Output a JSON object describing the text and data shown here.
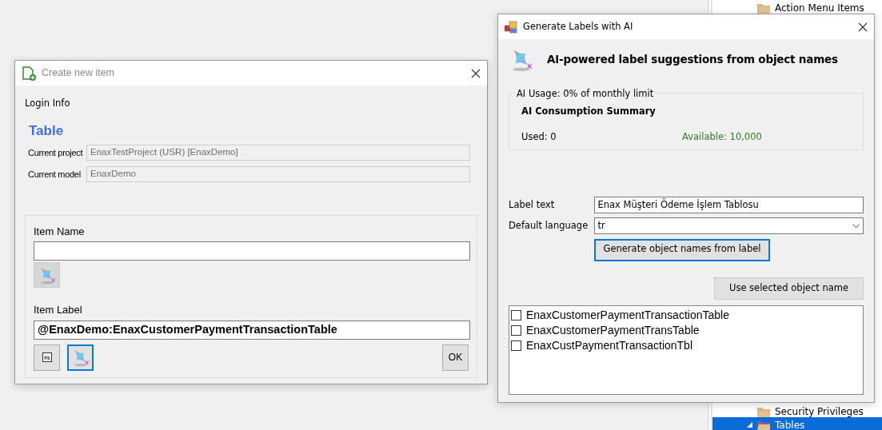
{
  "background_tree": {
    "items": [
      {
        "label": "Action Menu Items",
        "selected": false,
        "expanded": false
      },
      {
        "label": "Security Privileges",
        "selected": false,
        "expanded": false
      },
      {
        "label": "Tables",
        "selected": true,
        "expanded": true
      }
    ]
  },
  "create_dialog": {
    "title": "Create new item",
    "section": "Login Info",
    "item_type": "Table",
    "fields": [
      {
        "label": "Current project",
        "value": "EnaxTestProject (USR) [EnaxDemo]",
        "disabled": true
      },
      {
        "label": "Current model",
        "value": "EnaxDemo",
        "disabled": true
      }
    ],
    "item_name": {
      "label": "Item Name"
    },
    "item_label": {
      "label": "Item Label",
      "value": "@EnaxDemo:EnaxCustomerPaymentTransactionTable"
    },
    "ok_button": "OK"
  },
  "ai_dialog": {
    "title": "Generate Labels with AI",
    "heading": "AI-powered label suggestions from object names",
    "usage": {
      "legend": "AI Usage: 0% of monthly limit",
      "summary_title": "AI Consumption Summary",
      "used": "Used: 0",
      "available": "Available: 10,000"
    },
    "label_text": {
      "label": "Label text",
      "value": "Enax Müşteri Ödeme İşlem Tablosu"
    },
    "default_language": {
      "label": "Default language",
      "value": "tr"
    },
    "generate_button": "Generate object names from label",
    "use_button": "Use selected object name",
    "suggestions": [
      {
        "label": "EnaxCustomerPaymentTransactionTable",
        "checked": false
      },
      {
        "label": "EnaxCustomerPaymentTransTable",
        "checked": false
      },
      {
        "label": "EnaxCustPaymentTransactionTbl",
        "checked": false
      }
    ]
  }
}
